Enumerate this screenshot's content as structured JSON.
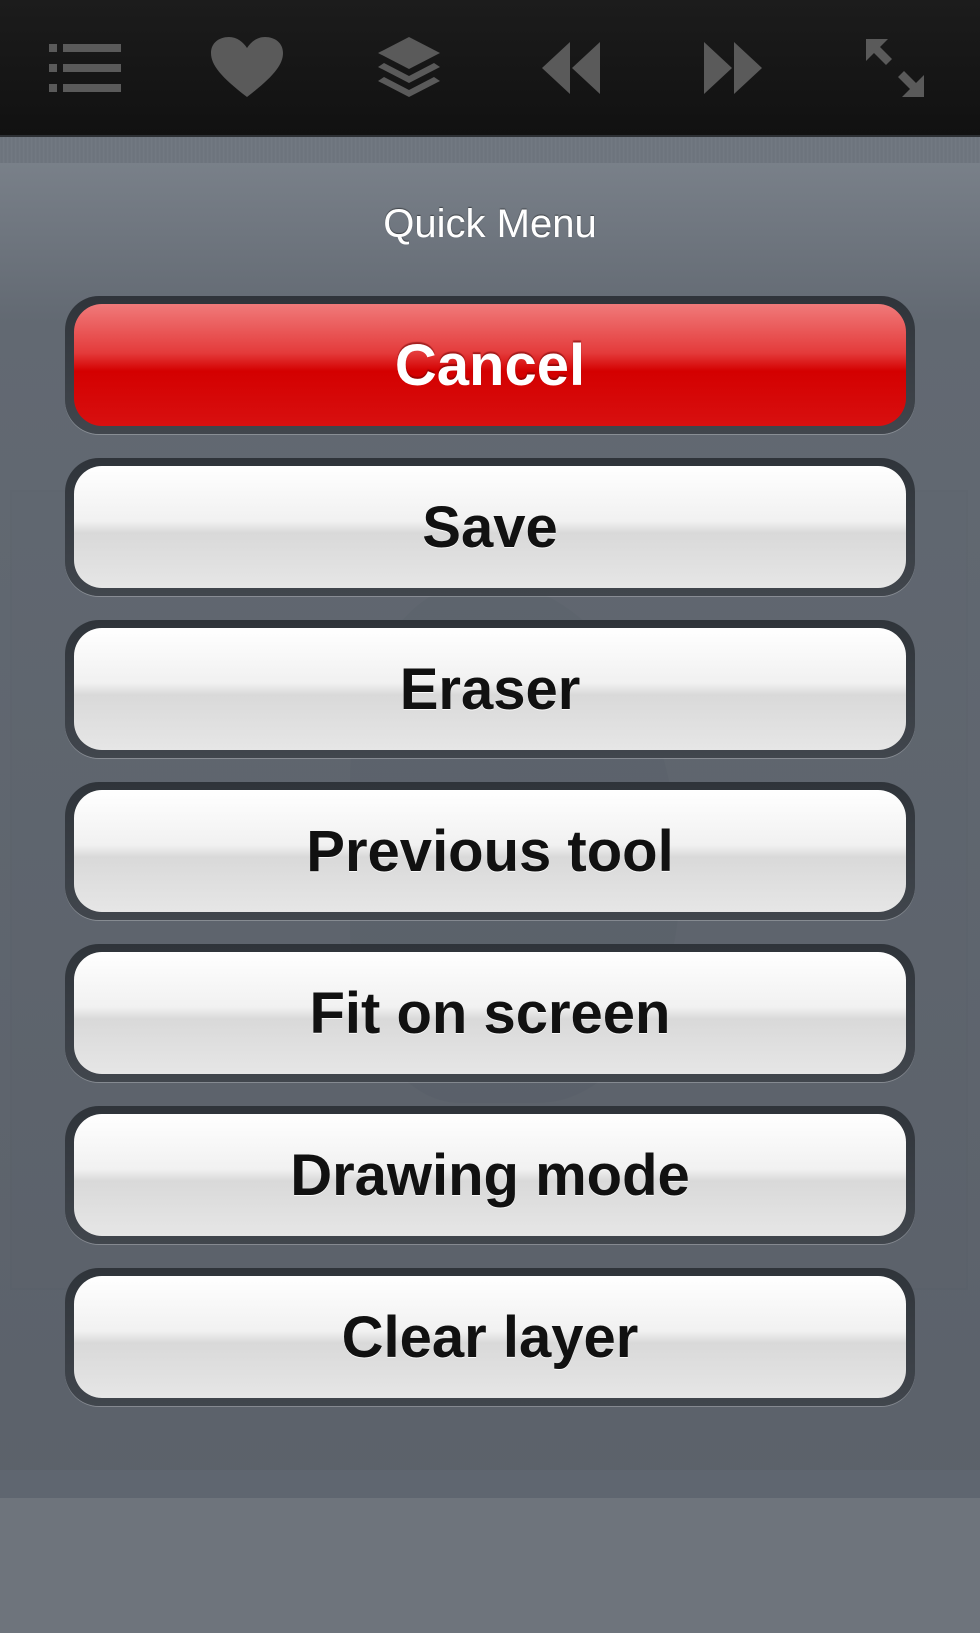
{
  "toolbar": {
    "icons": [
      "list-icon",
      "heart-icon",
      "layers-icon",
      "rewind-icon",
      "fast-forward-icon",
      "fullscreen-icon"
    ]
  },
  "menu": {
    "title": "Quick Menu",
    "buttons": {
      "cancel": "Cancel",
      "save": "Save",
      "eraser": "Eraser",
      "previous_tool": "Previous tool",
      "fit_on_screen": "Fit on screen",
      "drawing_mode": "Drawing mode",
      "clear_layer": "Clear layer"
    }
  },
  "colors": {
    "cancel_red": "#d40000",
    "toolbar_bg": "#1c1c1c",
    "icon_gray": "#5a5a5a"
  }
}
